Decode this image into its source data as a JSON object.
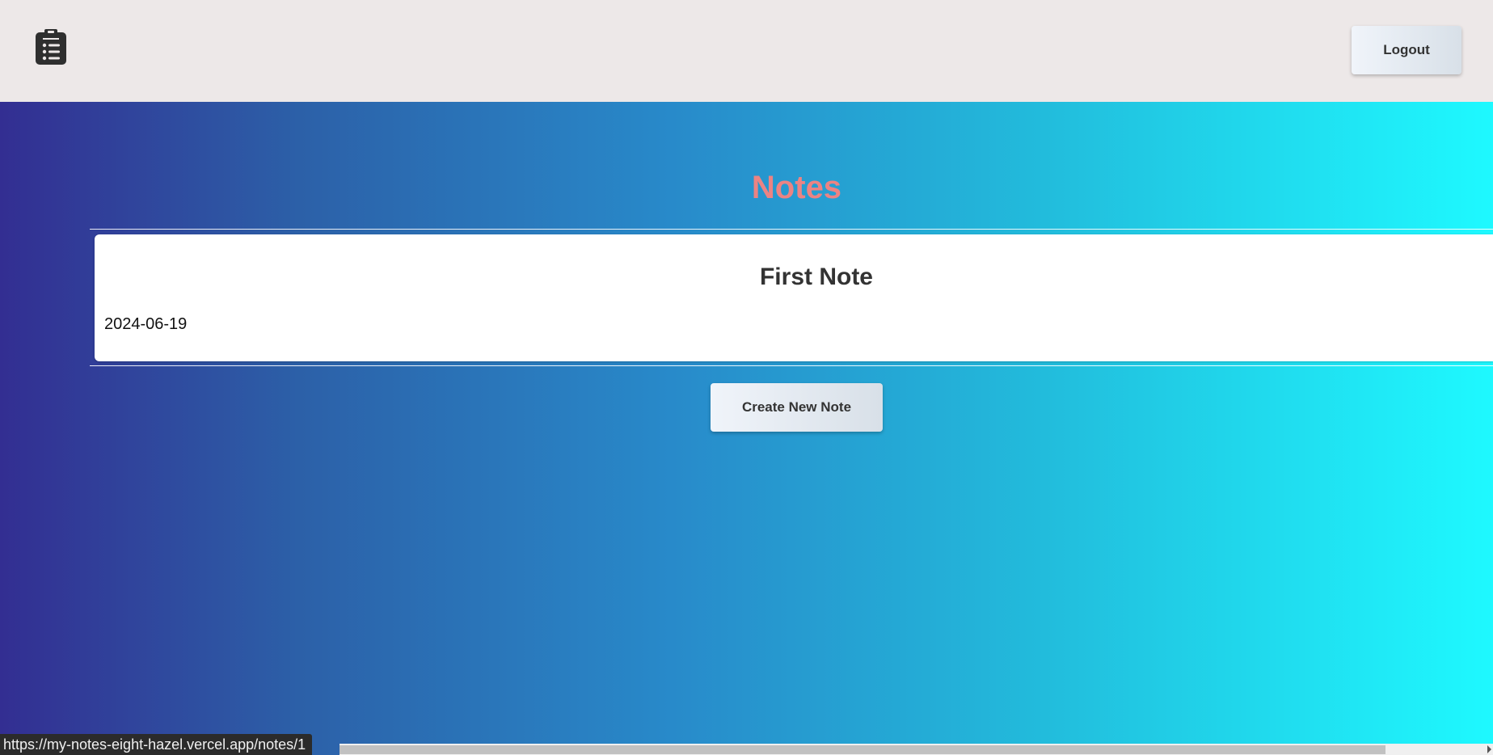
{
  "header": {
    "logo_icon": "clipboard-list-icon",
    "logout_label": "Logout"
  },
  "main": {
    "title": "Notes",
    "title_color": "#ec8383",
    "notes": [
      {
        "title": "First Note",
        "date": "2024-06-19"
      }
    ],
    "create_label": "Create New Note"
  },
  "status_bar": {
    "url": "https://my-notes-eight-hazel.vercel.app/notes/1"
  }
}
